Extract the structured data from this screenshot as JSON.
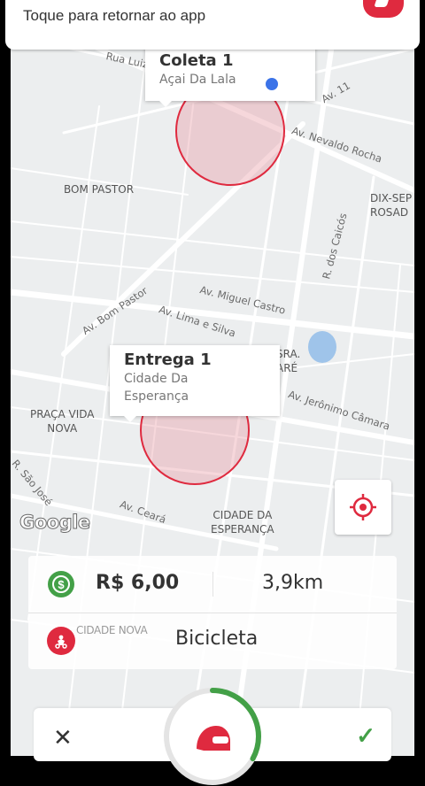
{
  "notification": {
    "text": "Toque para retornar ao app"
  },
  "map": {
    "pickup": {
      "title": "Coleta 1",
      "subtitle": "Açai Da Lala"
    },
    "dropoff": {
      "title": "Entrega 1",
      "subtitle_line1": "Cidade Da",
      "subtitle_line2": "Esperança"
    },
    "neighborhoods": {
      "bom_pastor": "BOM PASTOR",
      "dix_sept_1": "DIX-SEP",
      "dix_sept_2": "ROSAD",
      "praca_vida_1": "PRAÇA VIDA",
      "praca_vida_2": "NOVA",
      "cidade_esperanca_1": "CIDADE DA",
      "cidade_esperanca_2": "ESPERANÇA",
      "partial_1": "SRA.",
      "partial_2": "ARÉ"
    },
    "streets": {
      "rua_luiz": "Rua Luiz",
      "av_11": "Av. 11",
      "av_nevaldo": "Av. Nevaldo Rocha",
      "r_caicos": "R. dos Caicós",
      "av_miguel": "Av. Miguel Castro",
      "av_bom_pastor": "Av. Bom Pastor",
      "av_lima": "Av. Lima e Silva",
      "av_jeronimo": "Av. Jerônimo Câmara",
      "r_sao_jose": "R. São José",
      "av_ceara": "Av. Ceará"
    },
    "google_label": "Google",
    "locate_icon": "crosshair-icon"
  },
  "info": {
    "price": "R$ 6,00",
    "distance": "3,9km",
    "vehicle": "Bicicleta",
    "ghost_text": "CIDADE NOVA"
  },
  "actions": {
    "cancel": "✕",
    "confirm": "✓",
    "progress": 0.33
  },
  "colors": {
    "brand_red": "#df2a3f",
    "green": "#43a047"
  }
}
